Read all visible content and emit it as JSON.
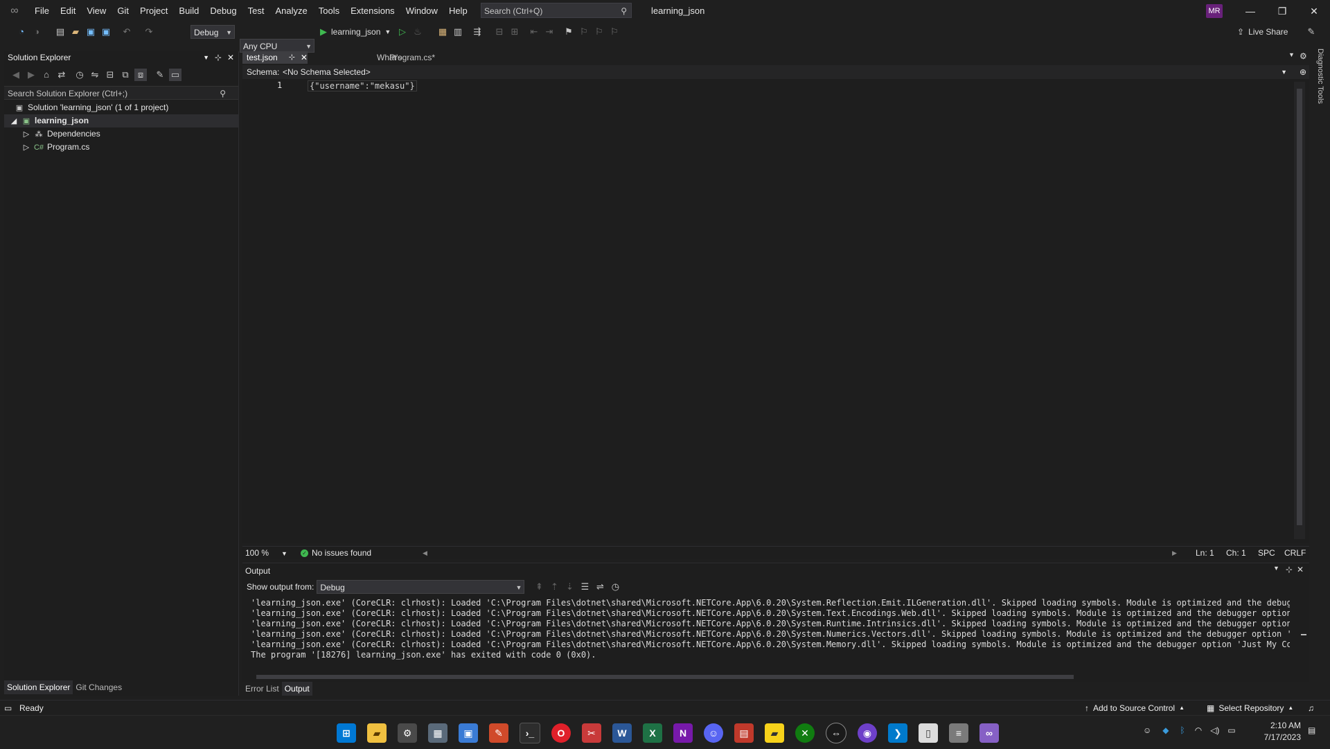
{
  "menu": [
    "File",
    "Edit",
    "View",
    "Git",
    "Project",
    "Build",
    "Debug",
    "Test",
    "Analyze",
    "Tools",
    "Extensions",
    "Window",
    "Help"
  ],
  "search_placeholder": "Search (Ctrl+Q)",
  "solution_title": "learning_json",
  "user_initials": "MR",
  "toolbar": {
    "config": "Debug",
    "platform": "Any CPU",
    "start_target": "learning_json",
    "live_share": "Live Share"
  },
  "solution_explorer": {
    "title": "Solution Explorer",
    "search_placeholder": "Search Solution Explorer (Ctrl+;)",
    "tree": [
      {
        "label": "Solution 'learning_json' (1 of 1 project)"
      },
      {
        "label": "learning_json"
      },
      {
        "label": "Dependencies"
      },
      {
        "label": "Program.cs"
      }
    ],
    "tabs": [
      "Solution Explorer",
      "Git Changes"
    ]
  },
  "editor": {
    "tabs": [
      {
        "label": "test.json",
        "pin": "⊹"
      },
      {
        "label": "What's New?"
      },
      {
        "label": "Program.cs*"
      }
    ],
    "schema_label": "Schema:",
    "schema_value": "<No Schema Selected>",
    "line_number": "1",
    "code_line": "{\"username\":\"mekasu\"}",
    "zoom": "100 %",
    "issues": "No issues found",
    "ln": "Ln: 1",
    "ch": "Ch: 1",
    "spc": "SPC",
    "crlf": "CRLF"
  },
  "output": {
    "title": "Output",
    "show_from_label": "Show output from:",
    "source": "Debug",
    "lines": "'learning_json.exe' (CoreCLR: clrhost): Loaded 'C:\\Program Files\\dotnet\\shared\\Microsoft.NETCore.App\\6.0.20\\System.Reflection.Emit.ILGeneration.dll'. Skipped loading symbols. Module is optimized and the debugger opt\n'learning_json.exe' (CoreCLR: clrhost): Loaded 'C:\\Program Files\\dotnet\\shared\\Microsoft.NETCore.App\\6.0.20\\System.Text.Encodings.Web.dll'. Skipped loading symbols. Module is optimized and the debugger option 'Just\n'learning_json.exe' (CoreCLR: clrhost): Loaded 'C:\\Program Files\\dotnet\\shared\\Microsoft.NETCore.App\\6.0.20\\System.Runtime.Intrinsics.dll'. Skipped loading symbols. Module is optimized and the debugger option 'Just\n'learning_json.exe' (CoreCLR: clrhost): Loaded 'C:\\Program Files\\dotnet\\shared\\Microsoft.NETCore.App\\6.0.20\\System.Numerics.Vectors.dll'. Skipped loading symbols. Module is optimized and the debugger option 'Just My\n'learning_json.exe' (CoreCLR: clrhost): Loaded 'C:\\Program Files\\dotnet\\shared\\Microsoft.NETCore.App\\6.0.20\\System.Memory.dll'. Skipped loading symbols. Module is optimized and the debugger option 'Just My Code' is\nThe program '[18276] learning_json.exe' has exited with code 0 (0x0).",
    "bottom_tabs": [
      "Error List",
      "Output"
    ]
  },
  "diagnostic_tools": "Diagnostic Tools",
  "statusbar": {
    "ready": "Ready",
    "source_control": "Add to Source Control",
    "repository": "Select Repository"
  },
  "taskbar": {
    "time": "2:10 AM",
    "date": "7/17/2023"
  },
  "colors": {
    "accent": "#68217a",
    "vs_purple": "#8660c5",
    "success": "#3fb950"
  }
}
